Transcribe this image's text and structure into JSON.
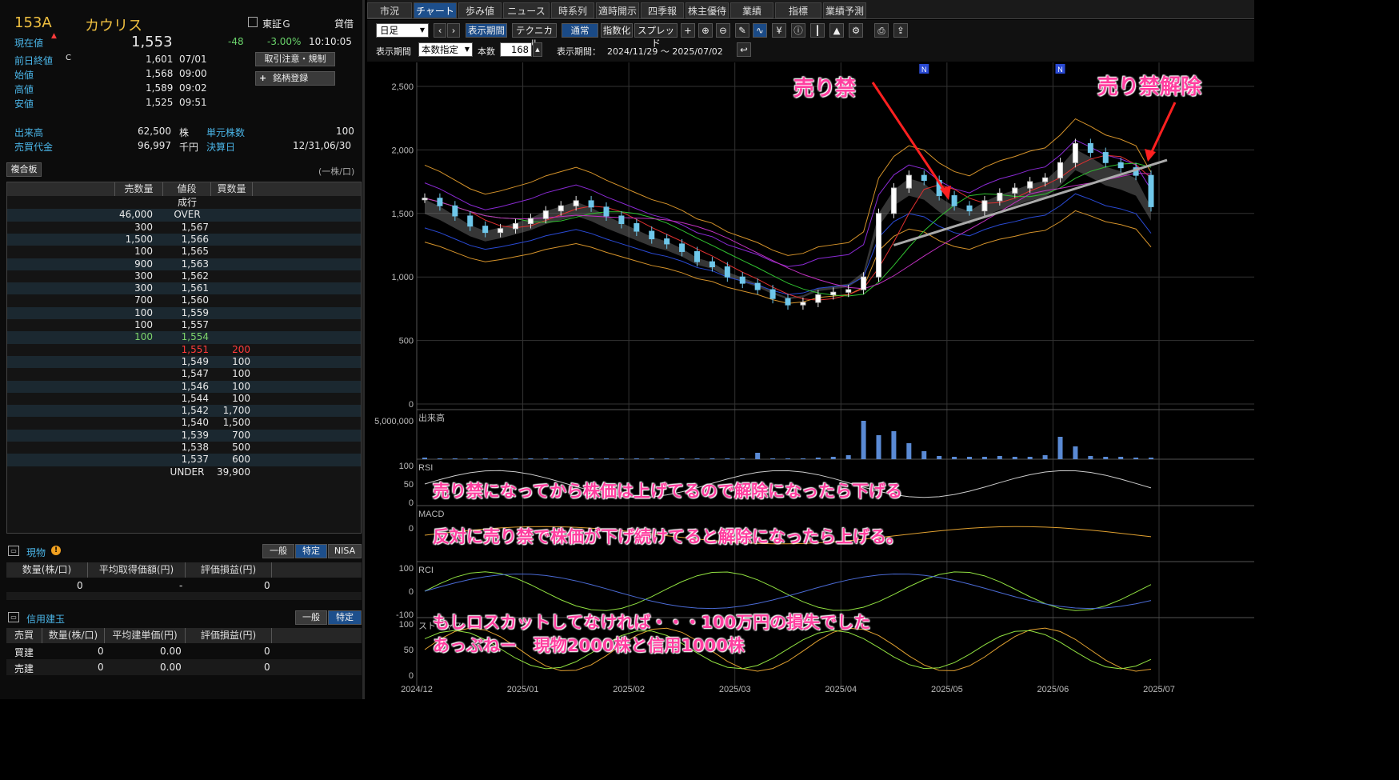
{
  "stock": {
    "code": "153A",
    "name": "カウリス",
    "market": "東証Ｇ",
    "loan": "貸借"
  },
  "quote": {
    "current_label": "現在値",
    "current_value": "1,553",
    "change": "-48",
    "change_pct": "-3.00%",
    "current_time": "10:10:05",
    "prev_label": "前日終値",
    "prev_flag": "C",
    "prev_value": "1,601",
    "prev_date": "07/01",
    "open_label": "始値",
    "open_value": "1,568",
    "open_time": "09:00",
    "high_label": "高値",
    "high_value": "1,589",
    "high_time": "09:02",
    "low_label": "安値",
    "low_value": "1,525",
    "low_time": "09:51",
    "volume_label": "出来高",
    "volume_value": "62,500",
    "volume_unit": "株",
    "unit_label": "単元株数",
    "unit_value": "100",
    "turnover_label": "売買代金",
    "turnover_value": "96,997",
    "turnover_unit": "千円",
    "settle_label": "決算日",
    "settle_value": "12/31,06/30"
  },
  "buttons": {
    "attention": "取引注意・規制",
    "register": "銘柄登録",
    "register_icon": "plus-icon"
  },
  "board": {
    "tab": "複合板",
    "unit_note": "(一株/口)",
    "headers": [
      "売数量",
      "値段",
      "買数量"
    ],
    "rows": [
      {
        "sell": "",
        "price": "成行",
        "buy": ""
      },
      {
        "sell": "46,000",
        "price": "OVER",
        "buy": ""
      },
      {
        "sell": "300",
        "price": "1,567",
        "buy": ""
      },
      {
        "sell": "1,500",
        "price": "1,566",
        "buy": ""
      },
      {
        "sell": "100",
        "price": "1,565",
        "buy": ""
      },
      {
        "sell": "900",
        "price": "1,563",
        "buy": ""
      },
      {
        "sell": "300",
        "price": "1,562",
        "buy": ""
      },
      {
        "sell": "300",
        "price": "1,561",
        "buy": ""
      },
      {
        "sell": "700",
        "price": "1,560",
        "buy": ""
      },
      {
        "sell": "100",
        "price": "1,559",
        "buy": ""
      },
      {
        "sell": "100",
        "price": "1,557",
        "buy": ""
      },
      {
        "sell": "100",
        "price": "1,554",
        "buy": ""
      },
      {
        "sell": "",
        "price": "1,551",
        "buy": "200"
      },
      {
        "sell": "",
        "price": "1,549",
        "buy": "100"
      },
      {
        "sell": "",
        "price": "1,547",
        "buy": "100"
      },
      {
        "sell": "",
        "price": "1,546",
        "buy": "100"
      },
      {
        "sell": "",
        "price": "1,544",
        "buy": "100"
      },
      {
        "sell": "",
        "price": "1,542",
        "buy": "1,700"
      },
      {
        "sell": "",
        "price": "1,540",
        "buy": "1,500"
      },
      {
        "sell": "",
        "price": "1,539",
        "buy": "700"
      },
      {
        "sell": "",
        "price": "1,538",
        "buy": "500"
      },
      {
        "sell": "",
        "price": "1,537",
        "buy": "600"
      },
      {
        "sell": "",
        "price": "UNDER",
        "buy": "39,900"
      }
    ],
    "colors": {
      "ask_best": "#7dd36b",
      "bid_best": "#ff3b3b"
    }
  },
  "spot": {
    "title": "現物",
    "tabs": [
      "一般",
      "特定",
      "NISA"
    ],
    "headers": [
      "数量(株/口)",
      "平均取得価額(円)",
      "評価損益(円)"
    ],
    "row": [
      "0",
      "-",
      "0"
    ]
  },
  "margin": {
    "title": "信用建玉",
    "tabs": [
      "一般",
      "特定"
    ],
    "headers": [
      "売買",
      "数量(株/口)",
      "平均建単価(円)",
      "評価損益(円)"
    ],
    "rows": [
      [
        "買建",
        "0",
        "0.00",
        "0"
      ],
      [
        "売建",
        "0",
        "0.00",
        "0"
      ]
    ]
  },
  "top_tabs": [
    "市況",
    "チャート",
    "歩み値",
    "ニュース",
    "時系列",
    "適時開示",
    "四季報",
    "株主優待",
    "業績",
    "指標",
    "業績予測"
  ],
  "toolbar": {
    "period": "日足",
    "display_period": "表示期間",
    "technical": "テクニカル",
    "normal": "通常",
    "indexed": "指数化",
    "spread": "スプレッド",
    "range_label": "表示期間",
    "range_mode": "本数指定",
    "count_label": "本数",
    "count_value": "168",
    "range_text_label": "表示期間：",
    "range_text": "2024/11/29 ～ 2025/07/02"
  },
  "chart_data": {
    "type": "line",
    "price_axis": {
      "ticks": [
        "2,500",
        "2,000",
        "1,500",
        "1,000",
        "500",
        "0"
      ],
      "ylim": [
        0,
        2500
      ]
    },
    "x_ticks": [
      "2024/12",
      "2025/01",
      "2025/02",
      "2025/03",
      "2025/04",
      "2025/05",
      "2025/06",
      "2025/07"
    ],
    "panels": [
      {
        "name": "出来高",
        "ticks": [
          "5,000,000"
        ]
      },
      {
        "name": "RSI",
        "ticks": [
          "100",
          "50",
          "0"
        ]
      },
      {
        "name": "MACD",
        "ticks": [
          "0"
        ]
      },
      {
        "name": "RCI",
        "ticks": [
          "100",
          "0",
          "-100"
        ]
      },
      {
        "name": "ストキャス",
        "ticks": [
          "100",
          "50",
          "0"
        ]
      }
    ],
    "close_series": [
      1620,
      1560,
      1480,
      1400,
      1350,
      1380,
      1420,
      1460,
      1520,
      1560,
      1600,
      1550,
      1480,
      1420,
      1360,
      1300,
      1260,
      1200,
      1120,
      1080,
      1000,
      950,
      900,
      830,
      780,
      800,
      860,
      880,
      900,
      1000,
      1500,
      1700,
      1800,
      1760,
      1640,
      1560,
      1520,
      1600,
      1660,
      1700,
      1750,
      1780,
      1900,
      2050,
      1980,
      1900,
      1860,
      1800,
      1553
    ],
    "volume_series": [
      0.2,
      0.1,
      0.1,
      0.1,
      0.1,
      0.1,
      0.1,
      0.1,
      0.1,
      0.1,
      0.1,
      0.1,
      0.1,
      0.1,
      0.1,
      0.1,
      0.1,
      0.1,
      0.1,
      0.1,
      0.1,
      0.1,
      0.8,
      0.1,
      0.1,
      0.1,
      0.2,
      0.3,
      0.5,
      4.8,
      3.0,
      3.5,
      2.0,
      1.0,
      0.4,
      0.3,
      0.3,
      0.3,
      0.4,
      0.3,
      0.3,
      0.5,
      2.8,
      1.6,
      0.4,
      0.3,
      0.3,
      0.2,
      0.2
    ]
  },
  "annotations": {
    "ban": "売り禁",
    "ban_lift": "売り禁解除",
    "note1": "売り禁になってから株価は上げてるので解除になったら下げる",
    "note2": "反対に売り禁で株価が下げ続けてると解除になったら上げる。",
    "note3": "もしロスカットしてなければ・・・100万円の損失でした",
    "note4": "あっぶねー　現物2000株と信用1000株"
  },
  "news_badge": "N"
}
